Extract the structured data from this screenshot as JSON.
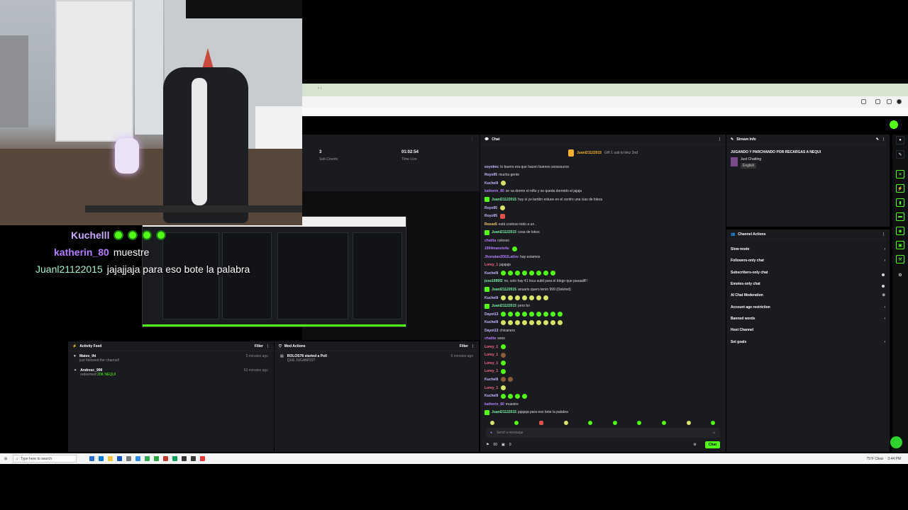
{
  "browser": {
    "tab_text": "‹ ›"
  },
  "stats": {
    "sub_counts_value": "3",
    "sub_counts_label": "Sub Counts",
    "time_live_value": "01:02:54",
    "time_live_label": "Time Live"
  },
  "activity_feed": {
    "title": "Activity Feed",
    "filter": "Filter",
    "items": [
      {
        "user": "Mateo_thi",
        "action": "just followed the channel!",
        "time": "5 minutes ago"
      },
      {
        "user": "Andresc_999",
        "action": "redeemed",
        "reward": "20K NEQUI",
        "time": "52 minutes ago"
      }
    ]
  },
  "mod_actions": {
    "title": "Mod Actions",
    "filter": "Filter",
    "items": [
      {
        "user": "ROLOS78",
        "action": "started a Poll",
        "detail": "QUE JUGAMOS?",
        "time": "5 minutes ago"
      }
    ]
  },
  "chat": {
    "title": "Chat",
    "pinned_user": "Juanl21122015",
    "pinned_text": "Gift 1 sub to lekz 2nd",
    "messages": [
      {
        "user": "eoyolmc",
        "color": "#c9b8ff",
        "text": "lo bueno era que hacen buenos ssosssuros"
      },
      {
        "user": "Royo95",
        "color": "#c9b8ff",
        "text": "mucha gente"
      },
      {
        "user": "Kuchelli",
        "color": "#c9b8ff",
        "text": "",
        "emotes": "y"
      },
      {
        "user": "katherin_80",
        "color": "#b57cff",
        "text": "se va dormir el niño y se queda dormido el jajaja"
      },
      {
        "user": "Juanl21122015",
        "color": "#7cf0a8",
        "text": "huy si yo tambn estuve en el centro una cias de lokoa",
        "badge": true
      },
      {
        "user": "Royo95",
        "color": "#c9b8ff",
        "text": "",
        "emotes": "y"
      },
      {
        "user": "Royo95",
        "color": "#c9b8ff",
        "text": "",
        "emotes": "r"
      },
      {
        "user": "Rosse5",
        "color": "#ffd36b",
        "text": "está costoso todo a un ."
      },
      {
        "user": "Juanl21122015",
        "color": "#7cf0a8",
        "text": "cosa de lokos",
        "badge": true
      },
      {
        "user": "chatita",
        "color": "#b57cff",
        "text": "colosso"
      },
      {
        "user": "1994manolo4u",
        "color": "#b57cff",
        "text": "",
        "emotes": "g"
      },
      {
        "user": "Jhonatan2002Latine",
        "color": "#b57cff",
        "text": "hay estamos"
      },
      {
        "user": "Lorey_1",
        "color": "#ff6b8a",
        "text": "jajajaja"
      },
      {
        "user": "Kuchelli",
        "color": "#c9b8ff",
        "text": "",
        "emotes": "gggggggg"
      },
      {
        "user": "jose1995f2",
        "color": "#7cf0a8",
        "text": "no, solo hay 41 loca subil para el bingo que pasaalll!!"
      },
      {
        "user": "Juanl21122015",
        "color": "#7cf0a8",
        "text": "anuaris quero tenío 999 (Deleted)",
        "badge": true
      },
      {
        "user": "Kuchelli",
        "color": "#c9b8ff",
        "text": "",
        "emotes": "yyyyyyy"
      },
      {
        "user": "Juanl21122015",
        "color": "#7cf0a8",
        "text": "pero bn",
        "badge": true
      },
      {
        "user": "Dayot13",
        "color": "#c9b8ff",
        "text": "",
        "emotes": "ggggggggg"
      },
      {
        "user": "Kuchelli",
        "color": "#c9b8ff",
        "text": "",
        "emotes": "yyyyyyyyy"
      },
      {
        "user": "Dayot13",
        "color": "#c9b8ff",
        "text": "chicanero"
      },
      {
        "user": "chatita",
        "color": "#b57cff",
        "text": "sooo"
      },
      {
        "user": "Lorey_1",
        "color": "#ff6b8a",
        "text": "",
        "emotes": "g"
      },
      {
        "user": "Lorey_1",
        "color": "#ff6b8a",
        "text": "",
        "emotes": "b"
      },
      {
        "user": "Lorey_1",
        "color": "#ff6b8a",
        "text": "",
        "emotes": "g"
      },
      {
        "user": "Lorey_1",
        "color": "#ff6b8a",
        "text": "",
        "emotes": "g"
      },
      {
        "user": "Kuchelli",
        "color": "#c9b8ff",
        "text": "",
        "emotes": "bb"
      },
      {
        "user": "Lorey_1",
        "color": "#ff6b8a",
        "text": "",
        "emotes": "y"
      },
      {
        "user": "Kuchelli",
        "color": "#c9b8ff",
        "text": "",
        "emotes": "gggg"
      },
      {
        "user": "katherin_80",
        "color": "#b57cff",
        "text": "muestre"
      },
      {
        "user": "Juanl21122015",
        "color": "#7cf0a8",
        "text": "jajajaja para eso bote la palabra",
        "badge": true
      }
    ],
    "input_placeholder": "Send a message",
    "footer_count1": "00",
    "footer_count2": "0",
    "chat_button": "Chat"
  },
  "stream_info": {
    "title_label": "Stream Info",
    "stream_title": "JUGANDO Y PARCHANDO POR RECARGAS A NEQUI",
    "category": "Just Chatting",
    "language": "English"
  },
  "channel_actions": {
    "title": "Channel Actions",
    "items": [
      {
        "label": "Slow mode",
        "control": "chevron"
      },
      {
        "label": "Followers-only chat",
        "control": "chevron"
      },
      {
        "label": "Subscribers-only chat",
        "control": "toggle"
      },
      {
        "label": "Emotes-only chat",
        "control": "toggle"
      },
      {
        "label": "AI Chat Moderation",
        "control": "settings"
      },
      {
        "label": "Account age restriction",
        "control": "chevron"
      },
      {
        "label": "Banned words",
        "control": "chevron"
      },
      {
        "label": "Host Channel",
        "control": "none"
      },
      {
        "label": "Set goals",
        "control": "chevron"
      }
    ]
  },
  "overlay": {
    "lines": [
      {
        "user": "Kuchelll",
        "color": "#c9a8ff",
        "text": ""
      },
      {
        "user": "katherin_80",
        "color": "#b57cff",
        "text": "muestre"
      },
      {
        "user": "Juanl21122015",
        "color": "#a8f0c8",
        "text": "jajajjaja para eso bote la palabra"
      }
    ]
  },
  "taskbar": {
    "search_placeholder": "Type here to search",
    "time": "3:44 PM",
    "temp": "75°F Clear"
  },
  "colors": {
    "accent": "#53fc18",
    "panel": "#191b1f"
  }
}
